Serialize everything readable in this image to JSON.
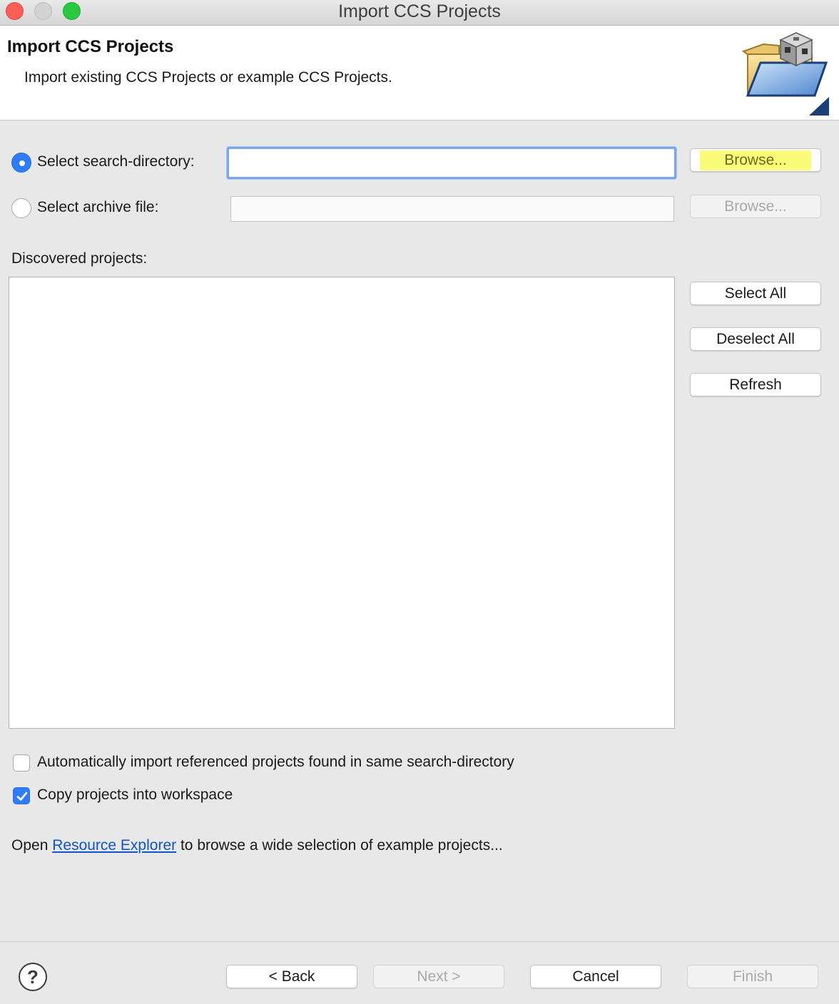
{
  "window": {
    "title": "Import CCS Projects"
  },
  "banner": {
    "title": "Import CCS Projects",
    "description": "Import existing CCS Projects or example CCS Projects.",
    "icon": "folder-with-cube-icon"
  },
  "source": {
    "search_directory": {
      "label": "Select search-directory:",
      "selected": true,
      "value": "",
      "browse_label": "Browse..."
    },
    "archive_file": {
      "label": "Select archive file:",
      "selected": false,
      "value": "",
      "browse_label": "Browse..."
    }
  },
  "projects": {
    "label": "Discovered projects:",
    "items": [],
    "select_all_label": "Select All",
    "deselect_all_label": "Deselect All",
    "refresh_label": "Refresh"
  },
  "options": {
    "auto_import": {
      "label": "Automatically import referenced projects found in same search-directory",
      "checked": false
    },
    "copy_into_workspace": {
      "label": "Copy projects into workspace",
      "checked": true
    }
  },
  "resource_line": {
    "prefix": "Open",
    "link": "Resource Explorer",
    "suffix": "to browse a wide selection of example projects..."
  },
  "footer": {
    "help_icon": "help-icon",
    "back_label": "< Back",
    "next_label": "Next >",
    "cancel_label": "Cancel",
    "finish_label": "Finish"
  },
  "colors": {
    "accent": "#2f7cf6",
    "highlight": "#fbfb7a",
    "link": "#1155cc"
  }
}
